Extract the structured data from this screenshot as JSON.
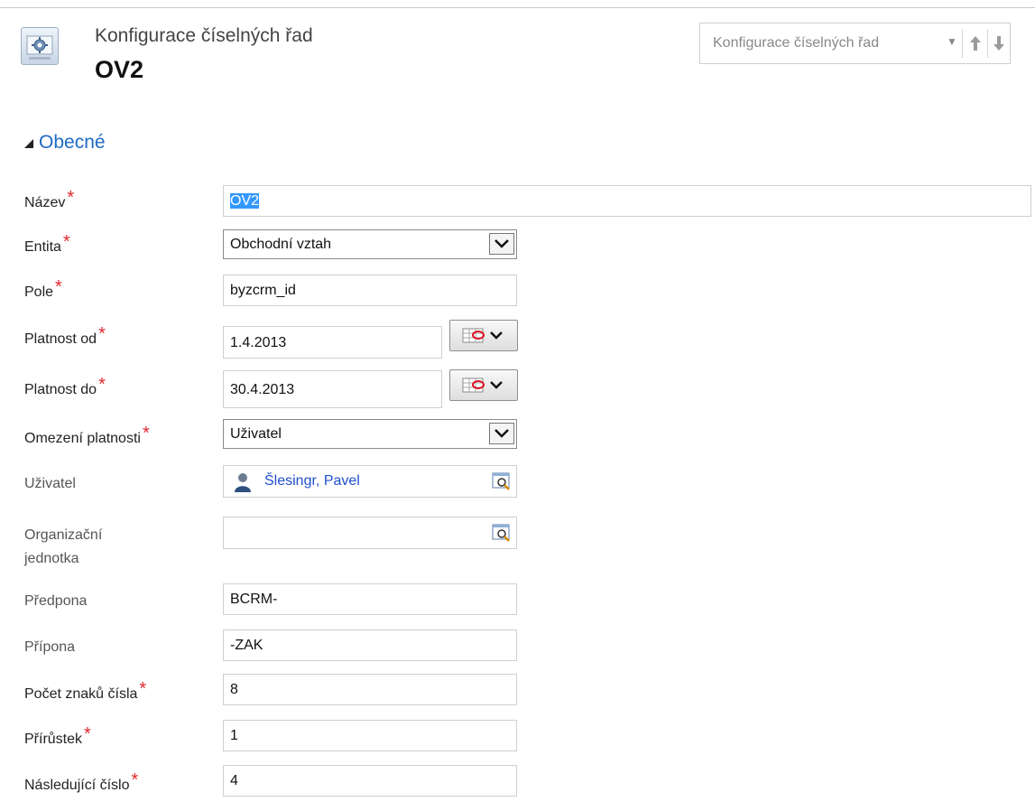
{
  "header": {
    "entity_type": "Konfigurace číselných řad",
    "record_name": "OV2",
    "icon": "gear-icon",
    "nav": {
      "label": "Konfigurace číselných řad",
      "dropdown_icon": "caret-down-icon",
      "up_icon": "arrow-up-icon",
      "down_icon": "arrow-down-icon"
    }
  },
  "section": {
    "title": "Obecné",
    "icon": "collapse-triangle-icon"
  },
  "form": {
    "nazev": {
      "label": "Název",
      "value": "OV2",
      "required": "*"
    },
    "entita": {
      "label": "Entita",
      "value": "Obchodní vztah",
      "required": "*"
    },
    "pole": {
      "label": "Pole",
      "value": "byzcrm_id",
      "required": "*"
    },
    "platnost_od": {
      "label": "Platnost od",
      "value": "1.4.2013",
      "required": "*"
    },
    "platnost_do": {
      "label": "Platnost do",
      "value": "30.4.2013",
      "required": "*"
    },
    "omezeni": {
      "label": "Omezení platnosti",
      "value": "Uživatel",
      "required": "*"
    },
    "uzivatel": {
      "label": "Uživatel",
      "value": "Šlesingr, Pavel"
    },
    "org_label_line1": "Organizační",
    "org_label_line2": "jednotka",
    "predpona": {
      "label": "Předpona",
      "value": "BCRM-"
    },
    "pripona": {
      "label": "Přípona",
      "value": "-ZAK"
    },
    "pocet_znaku": {
      "label": "Počet znaků čísla",
      "value": "8",
      "required": "*"
    },
    "prirustek": {
      "label": "Přírůstek",
      "value": "1",
      "required": "*"
    },
    "nasledujici": {
      "label": "Následující číslo",
      "value": "4",
      "required": "*"
    }
  },
  "colors": {
    "accent": "#1f6bc4",
    "required": "#e0282e",
    "link": "#1f4fd0",
    "selection": "#3399ff"
  }
}
